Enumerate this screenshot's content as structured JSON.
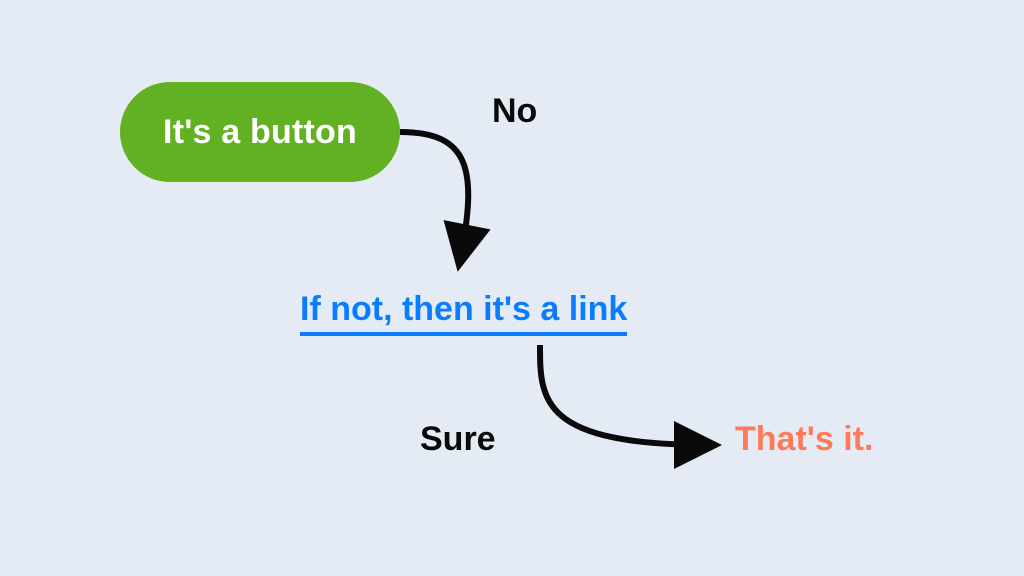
{
  "flow": {
    "node_button": "It's a button",
    "edge_no": "No",
    "node_link": "If not, then it's a link",
    "edge_sure": "Sure",
    "node_end": "That's it."
  }
}
